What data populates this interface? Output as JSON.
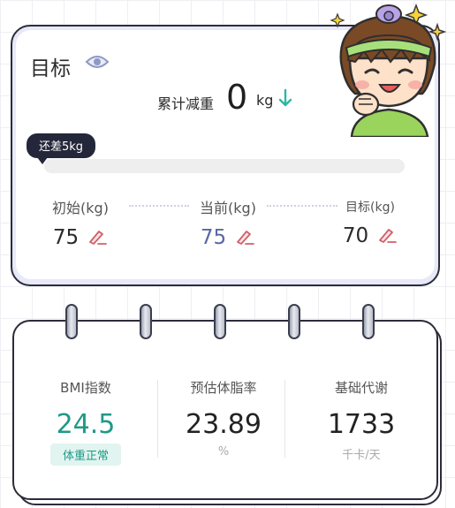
{
  "goal": {
    "title": "目标",
    "weight_loss_label": "累计减重",
    "weight_loss_value": "0",
    "weight_loss_unit": "kg",
    "remaining_text": "还差5kg",
    "progress_fraction": 0.0,
    "initial_label": "初始(kg)",
    "initial_value": "75",
    "current_label": "当前(kg)",
    "current_value": "75",
    "target_label": "目标(kg)",
    "target_value": "70"
  },
  "stats": {
    "bmi_label": "BMI指数",
    "bmi_value": "24.5",
    "bmi_status": "体重正常",
    "body_fat_label": "预估体脂率",
    "body_fat_value": "23.89",
    "body_fat_unit": "%",
    "bmr_label": "基础代谢",
    "bmr_value": "1733",
    "bmr_unit": "千卡/天"
  },
  "colors": {
    "current_value": "#5b67a3",
    "bmi_value": "#1e9a86",
    "arrow": "#2bb8a3",
    "edit_icon": "#d0606a"
  },
  "icons": {
    "eye": "eye-icon",
    "arrow": "down-arrow-icon",
    "edit": "edit-icon"
  }
}
